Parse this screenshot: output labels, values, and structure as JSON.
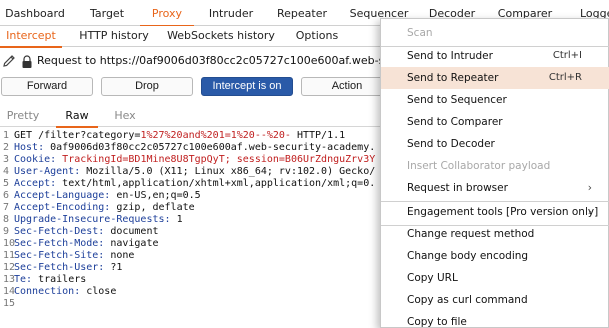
{
  "tool_tabs": [
    "Dashboard",
    "Target",
    "Proxy",
    "Intruder",
    "Repeater",
    "Sequencer",
    "Decoder",
    "Comparer",
    "Logge"
  ],
  "sub_tabs": [
    "Intercept",
    "HTTP history",
    "WebSockets history",
    "Options"
  ],
  "request_line": "Request to https://0af9006d03f80cc2c05727c100e600af.web-security-acad",
  "buttons": {
    "forward": "Forward",
    "drop": "Drop",
    "intercept": "Intercept is on",
    "action": "Action"
  },
  "view_tabs": [
    "Pretty",
    "Raw",
    "Hex"
  ],
  "lines": [
    {
      "n": "1",
      "a": "GET /filter?category=",
      "b": "1%27%20and%201=1%20--%20-",
      "c": " HTTP/1.1"
    },
    {
      "n": "2",
      "a": "Host: ",
      "b": "",
      "c": "0af9006d03f80cc2c05727c100e600af.web-security-academy."
    },
    {
      "n": "3",
      "a": "Cookie: ",
      "b": "TrackingId=BD1Mine8U8TgpQyT; session=B06UrZdnguZrv3Y",
      "c": ""
    },
    {
      "n": "4",
      "a": "User-Agent: ",
      "b": "",
      "c": "Mozilla/5.0 (X11; Linux x86_64; rv:102.0) Gecko/"
    },
    {
      "n": "5",
      "a": "Accept: ",
      "b": "",
      "c": "text/html,application/xhtml+xml,application/xml;q=0."
    },
    {
      "n": "6",
      "a": "Accept-Language: ",
      "b": "",
      "c": "en-US,en;q=0.5"
    },
    {
      "n": "7",
      "a": "Accept-Encoding: ",
      "b": "",
      "c": "gzip, deflate"
    },
    {
      "n": "8",
      "a": "Upgrade-Insecure-Requests: ",
      "b": "",
      "c": "1"
    },
    {
      "n": "9",
      "a": "Sec-Fetch-Dest: ",
      "b": "",
      "c": "document"
    },
    {
      "n": "10",
      "a": "Sec-Fetch-Mode: ",
      "b": "",
      "c": "navigate"
    },
    {
      "n": "11",
      "a": "Sec-Fetch-Site: ",
      "b": "",
      "c": "none"
    },
    {
      "n": "12",
      "a": "Sec-Fetch-User: ",
      "b": "",
      "c": "?1"
    },
    {
      "n": "13",
      "a": "Te: ",
      "b": "",
      "c": "trailers"
    },
    {
      "n": "14",
      "a": "Connection: ",
      "b": "",
      "c": "close"
    },
    {
      "n": "15",
      "a": "",
      "b": "",
      "c": ""
    }
  ],
  "menu": {
    "scan": "Scan",
    "send_to_intruder": "Send to Intruder",
    "send_to_intruder_shortcut": "Ctrl+I",
    "send_to_repeater": "Send to Repeater",
    "send_to_repeater_shortcut": "Ctrl+R",
    "send_to_sequencer": "Send to Sequencer",
    "send_to_comparer": "Send to Comparer",
    "send_to_decoder": "Send to Decoder",
    "insert_collaborator": "Insert Collaborator payload",
    "request_in_browser": "Request in browser",
    "engagement_tools": "Engagement tools [Pro version only]",
    "change_request_method": "Change request method",
    "change_body_encoding": "Change body encoding",
    "copy_url": "Copy URL",
    "copy_as_curl": "Copy as curl command",
    "copy_to_file": "Copy to file"
  },
  "colors": {
    "accent": "#e8651a",
    "primary_button": "#2a5aa8",
    "header_name": "#1d3f9a",
    "highlight": "#c02020"
  },
  "icons": {
    "edit": "pencil-icon",
    "secure": "lock-icon",
    "submenu": "chevron-right-icon"
  }
}
